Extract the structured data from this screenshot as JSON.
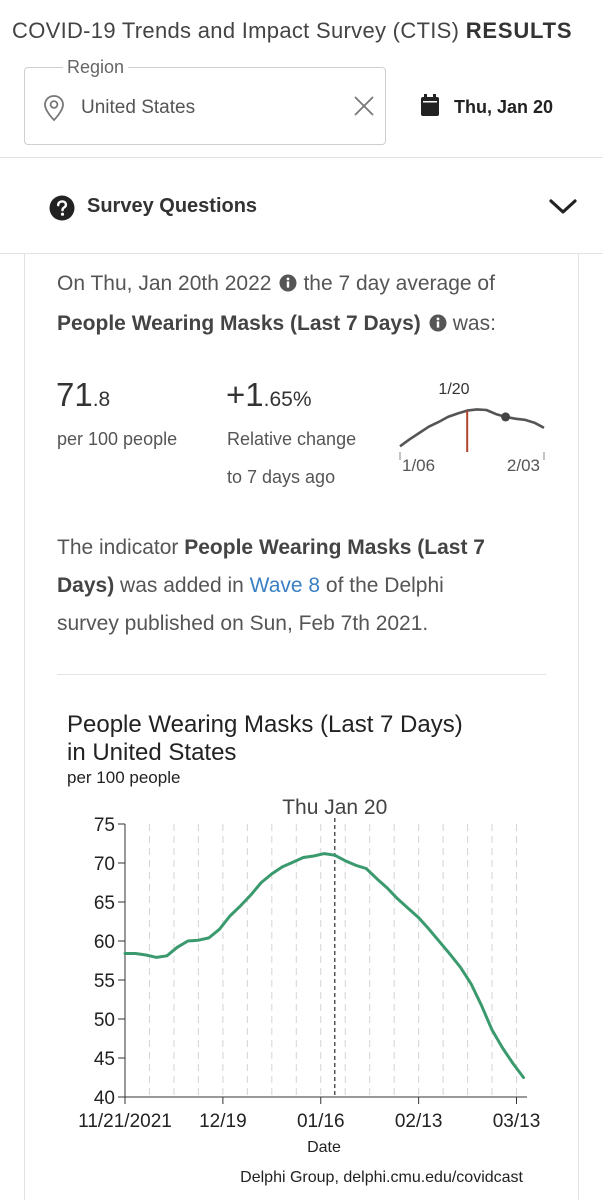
{
  "header": {
    "title": "COVID-19 Trends and Impact Survey (CTIS)",
    "title_bold": "RESULTS",
    "region_label": "Region",
    "region_value": "United States",
    "date": "Thu, Jan 20"
  },
  "survey_questions": {
    "label": "Survey Questions"
  },
  "summary": {
    "intro_prefix": "On Thu, Jan 20th 2022",
    "intro_suffix": "the 7 day average of",
    "indicator": "People Wearing Masks (Last 7 Days)",
    "was": "was:",
    "value_int": "71",
    "value_dec": ".8",
    "value_unit": "per 100 people",
    "change_int": "+1",
    "change_dec": ".65%",
    "change_label1": "Relative change",
    "change_label2": "to 7 days ago",
    "sparkline": {
      "label_top": "1/20",
      "label_left": "1/06",
      "label_right": "2/03",
      "values": [
        65.0,
        66.2,
        67.3,
        68.4,
        69.2,
        70.1,
        70.7,
        71.2,
        71.4,
        71.3,
        70.6,
        70.1,
        69.8,
        69.6,
        69.1,
        68.2
      ],
      "highlight_index": 7,
      "marker_index": 11
    },
    "wave_p1": "The indicator",
    "wave_bold1": "People Wearing Masks (Last 7",
    "wave_bold2": "Days)",
    "wave_p2": "was added in",
    "wave_link": "Wave 8",
    "wave_p3": "of the Delphi",
    "wave_p4": "survey published on Sun, Feb 7th 2021."
  },
  "chart_data": {
    "type": "line",
    "title_line1": "People Wearing Masks (Last 7 Days)",
    "title_line2": "in United States",
    "subtitle": "per 100 people",
    "xlabel": "Date",
    "ylabel": "",
    "ylim": [
      40,
      75
    ],
    "yticks": [
      40,
      45,
      50,
      55,
      60,
      65,
      70,
      75
    ],
    "xticks": [
      "11/21/2021",
      "12/19",
      "01/16",
      "02/13",
      "03/13"
    ],
    "x_range_days": [
      0,
      115
    ],
    "xtick_days": [
      0,
      28,
      56,
      84,
      112
    ],
    "highlight_label": "Thu Jan 20",
    "highlight_day": 60,
    "grid": "vertical-dashed",
    "series_color": "#3a9a6e",
    "source": "Delphi Group, delphi.cmu.edu/covidcast",
    "series": [
      {
        "x": [
          0,
          3,
          6,
          9,
          12,
          15,
          18,
          21,
          24,
          27,
          30,
          33,
          36,
          39,
          42,
          45,
          48,
          51,
          54,
          57,
          60,
          63,
          66,
          69,
          72,
          75,
          78,
          81,
          84,
          87,
          90,
          93,
          96,
          99,
          102,
          105,
          108,
          111,
          114
        ],
        "y": [
          58.4,
          58.4,
          58.2,
          57.9,
          58.1,
          59.2,
          60.0,
          60.1,
          60.4,
          61.5,
          63.2,
          64.5,
          65.9,
          67.5,
          68.6,
          69.5,
          70.1,
          70.7,
          70.9,
          71.2,
          71.0,
          70.3,
          69.7,
          69.3,
          68.0,
          66.8,
          65.4,
          64.2,
          63.0,
          61.5,
          59.9,
          58.3,
          56.6,
          54.5,
          51.7,
          48.6,
          46.3,
          44.3,
          42.5
        ]
      }
    ]
  }
}
